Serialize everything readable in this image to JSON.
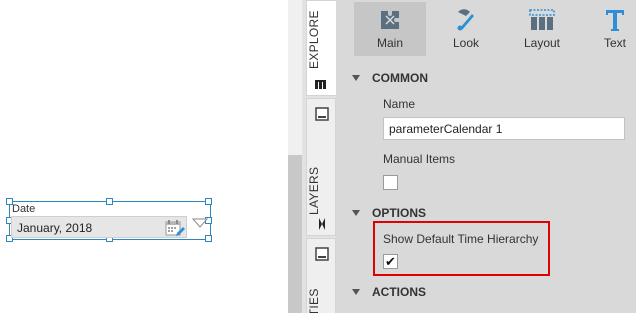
{
  "canvas": {
    "widget": {
      "label": "Date",
      "value": "January, 2018",
      "icon": "calendar-edit-icon"
    }
  },
  "side_tabs": [
    {
      "label": "EXPLORE",
      "icon": "explore-icon"
    },
    {
      "label": "LAYERS",
      "icon": "layers-icon"
    },
    {
      "label": "RTIES",
      "icon": "properties-icon"
    }
  ],
  "toolbar": {
    "tabs": [
      {
        "label": "Main",
        "icon": "main-puzzle-icon",
        "active": true
      },
      {
        "label": "Look",
        "icon": "look-brush-icon",
        "active": false
      },
      {
        "label": "Layout",
        "icon": "layout-grid-icon",
        "active": false
      },
      {
        "label": "Text",
        "icon": "text-t-icon",
        "active": false
      }
    ]
  },
  "sections": {
    "common": {
      "title": "COMMON",
      "name_label": "Name",
      "name_value": "parameterCalendar 1",
      "manual_items_label": "Manual Items",
      "manual_items_checked": false
    },
    "options": {
      "title": "OPTIONS",
      "show_default_time_hierarchy_label": "Show Default Time Hierarchy",
      "show_default_time_hierarchy_checked": true,
      "check_glyph": "✔"
    },
    "actions": {
      "title": "ACTIONS"
    }
  },
  "colors": {
    "selection_blue": "#2e86c1",
    "highlight_red": "#e00000",
    "panel_gray": "#d9d9d9",
    "icon_blue": "#2e8fd6"
  }
}
